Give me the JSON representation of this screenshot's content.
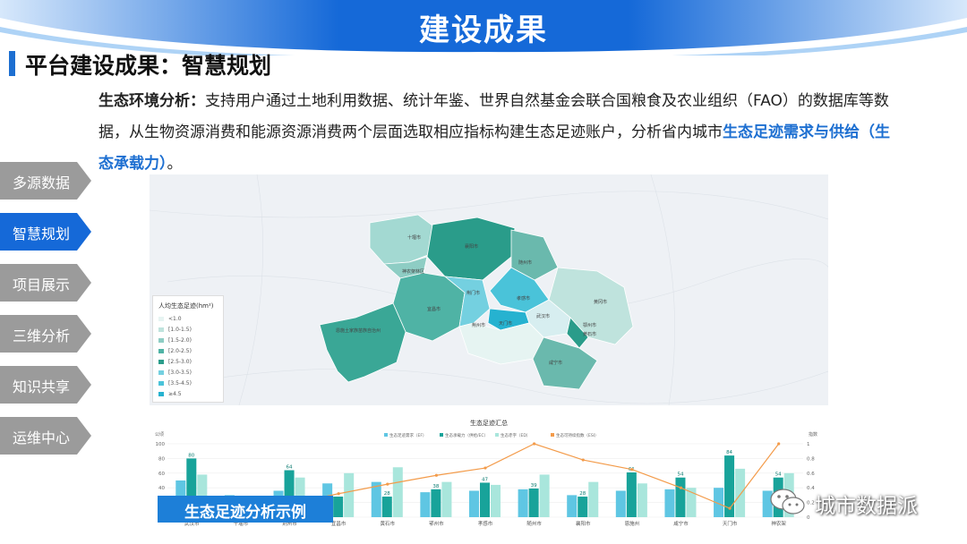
{
  "banner": {
    "title": "建设成果"
  },
  "section": {
    "title": "平台建设成果：智慧规划"
  },
  "intro": {
    "label": "生态环境分析：",
    "text": "支持用户通过土地利用数据、统计年鉴、世界自然基金会联合国粮食及农业组织（FAO）的数据库等数据，从生物资源消费和能源资源消费两个层面选取相应指标构建生态足迹账户，分析省内城市",
    "highlight": "生态足迹需求与供给（生态承载力）",
    "end": "。"
  },
  "nav": [
    {
      "label": "多源数据",
      "active": false
    },
    {
      "label": "智慧规划",
      "active": true
    },
    {
      "label": "项目展示",
      "active": false
    },
    {
      "label": "三维分析",
      "active": false
    },
    {
      "label": "知识共享",
      "active": false
    },
    {
      "label": "运维中心",
      "active": false
    }
  ],
  "map": {
    "legend_title": "人均生态足迹(hm²)",
    "legend_items": [
      {
        "label": "<1.0",
        "color": "#e6f4f2"
      },
      {
        "label": "[1.0-1.5)",
        "color": "#bfe3dd"
      },
      {
        "label": "[1.5-2.0)",
        "color": "#8ecdc4"
      },
      {
        "label": "[2.0-2.5)",
        "color": "#4fb3a5"
      },
      {
        "label": "[2.5-3.0)",
        "color": "#2a9c8a"
      },
      {
        "label": "[3.0-3.5)",
        "color": "#74d0e0"
      },
      {
        "label": "[3.5-4.5)",
        "color": "#4ac3d9"
      },
      {
        "label": "≥4.5",
        "color": "#26b2d0"
      }
    ],
    "cities": [
      "十堰市",
      "襄阳市",
      "随州市",
      "孝感市",
      "荆门市",
      "天门市",
      "潜江市",
      "武汉市",
      "鄂州市",
      "黄石市",
      "咸宁市",
      "荆州市",
      "宜昌市",
      "恩施土家族苗族自治州",
      "神农架林区",
      "黄冈市",
      "仙桃市"
    ]
  },
  "chart": {
    "title": "生态足迹汇总",
    "legend": [
      "生态足迹需求（EF）",
      "生态承载力（供给/EC）",
      "生态赤字（ED）",
      "生态可持续指数（ESI）"
    ],
    "left_unit": "公顷",
    "right_unit": "指数",
    "colors": {
      "ef": "#5fc6e3",
      "ec": "#18a39a",
      "ed": "#a9e6dc",
      "esi": "#f39b4a"
    }
  },
  "chart_data": {
    "type": "bar",
    "title": "生态足迹汇总",
    "categories": [
      "武汉市",
      "十堰市",
      "荆州市",
      "宜昌市",
      "黄石市",
      "鄂州市",
      "孝感市",
      "随州市",
      "襄阳市",
      "恩施州",
      "咸宁市",
      "天门市",
      "神农架"
    ],
    "series": [
      {
        "name": "生态足迹需求（EF）",
        "values": [
          50,
          30,
          36,
          46,
          48,
          34,
          36,
          38,
          30,
          36,
          38,
          40,
          36
        ]
      },
      {
        "name": "生态承载力（供给/EC）",
        "values": [
          80,
          10,
          64,
          28,
          28,
          38,
          47,
          39,
          28,
          61,
          54,
          84,
          54
        ]
      },
      {
        "name": "生态赤字（ED）",
        "values": [
          58,
          26,
          54,
          60,
          68,
          48,
          44,
          58,
          48,
          46,
          40,
          66,
          60
        ]
      },
      {
        "name": "生态可持续指数（ESI）",
        "values": [
          0.0,
          0.1,
          0.18,
          0.32,
          0.45,
          0.57,
          0.67,
          1.0,
          0.78,
          0.65,
          0.4,
          0.12,
          1.0
        ]
      }
    ],
    "data_labels": [
      "80",
      "",
      "64",
      "",
      "28",
      "38",
      "47",
      "39",
      "28",
      "61",
      "54",
      "84",
      "54"
    ],
    "ylim": [
      0,
      100
    ],
    "y_ticks": [
      "0",
      "20",
      "40",
      "60",
      "80",
      "100"
    ],
    "y2lim": [
      0,
      1
    ],
    "y2_ticks": [
      "0",
      "0.2",
      "0.4",
      "0.6",
      "0.8",
      "1"
    ],
    "ylabel": "公顷",
    "y2label": "指数"
  },
  "caption": {
    "text": "生态足迹分析示例"
  },
  "watermark": {
    "text": "城市数据派"
  }
}
